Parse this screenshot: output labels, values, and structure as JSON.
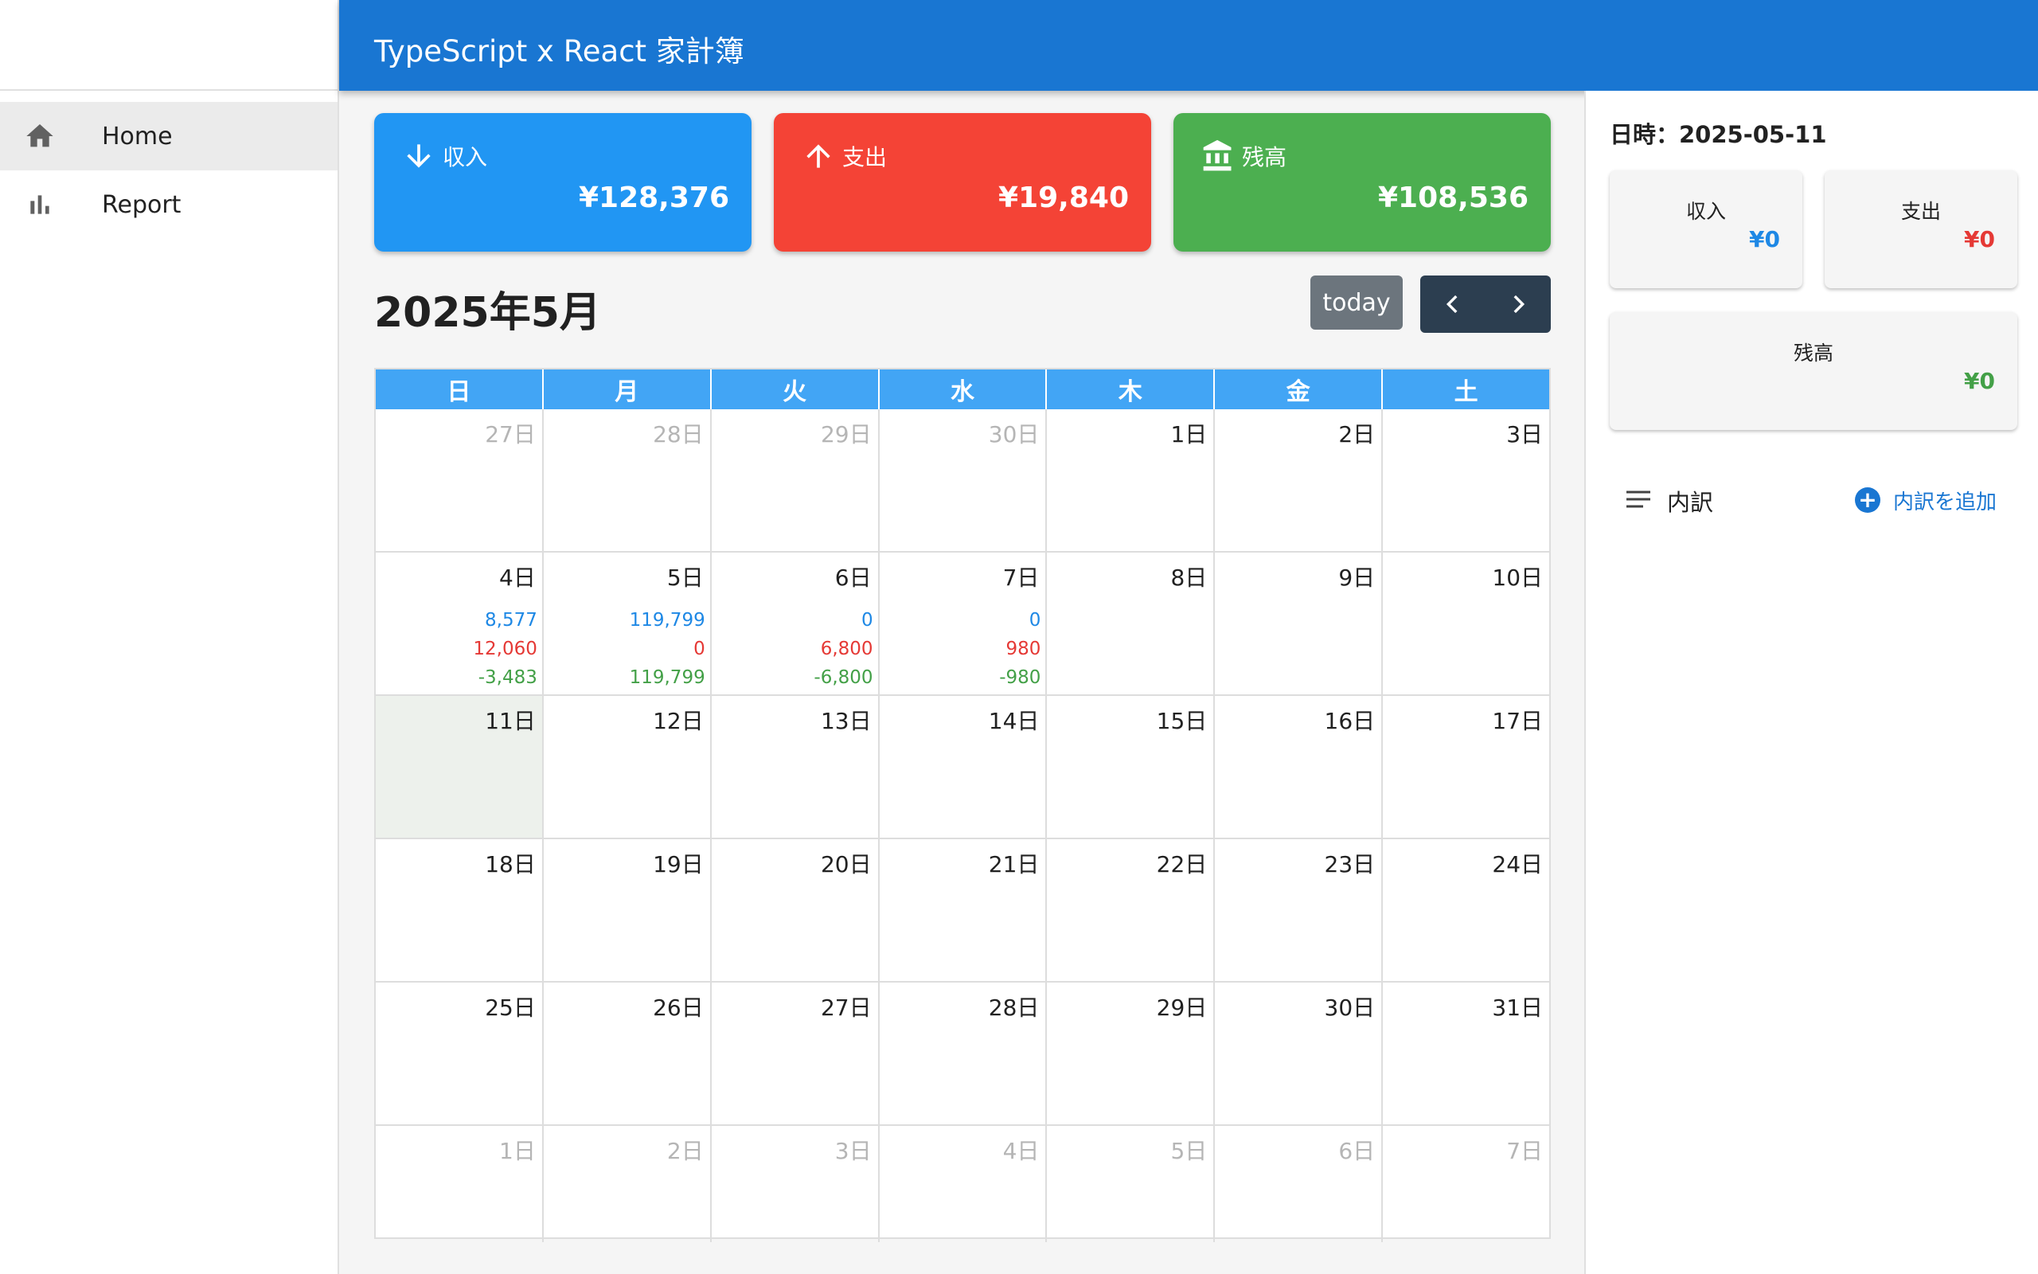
{
  "app": {
    "title": "TypeScript x React 家計簿"
  },
  "sidebar": {
    "items": [
      {
        "label": "Home",
        "icon": "home-icon"
      },
      {
        "label": "Report",
        "icon": "bar-chart-icon"
      }
    ]
  },
  "summary": {
    "income": {
      "label": "収入",
      "amount": "¥128,376",
      "color": "#2196f3"
    },
    "expense": {
      "label": "支出",
      "amount": "¥19,840",
      "color": "#f44336"
    },
    "balance": {
      "label": "残高",
      "amount": "¥108,536",
      "color": "#4caf50"
    }
  },
  "calendar": {
    "month_title": "2025年5月",
    "today_label": "today",
    "weekdays": [
      "日",
      "月",
      "火",
      "水",
      "木",
      "金",
      "土"
    ],
    "weeks": [
      [
        {
          "day": "27日",
          "other": true
        },
        {
          "day": "28日",
          "other": true
        },
        {
          "day": "29日",
          "other": true
        },
        {
          "day": "30日",
          "other": true
        },
        {
          "day": "1日"
        },
        {
          "day": "2日"
        },
        {
          "day": "3日"
        }
      ],
      [
        {
          "day": "4日",
          "income": "8,577",
          "expense": "12,060",
          "balance": "-3,483"
        },
        {
          "day": "5日",
          "income": "119,799",
          "expense": "0",
          "balance": "119,799"
        },
        {
          "day": "6日",
          "income": "0",
          "expense": "6,800",
          "balance": "-6,800"
        },
        {
          "day": "7日",
          "income": "0",
          "expense": "980",
          "balance": "-980"
        },
        {
          "day": "8日"
        },
        {
          "day": "9日"
        },
        {
          "day": "10日"
        }
      ],
      [
        {
          "day": "11日",
          "today": true
        },
        {
          "day": "12日"
        },
        {
          "day": "13日"
        },
        {
          "day": "14日"
        },
        {
          "day": "15日"
        },
        {
          "day": "16日"
        },
        {
          "day": "17日"
        }
      ],
      [
        {
          "day": "18日"
        },
        {
          "day": "19日"
        },
        {
          "day": "20日"
        },
        {
          "day": "21日"
        },
        {
          "day": "22日"
        },
        {
          "day": "23日"
        },
        {
          "day": "24日"
        }
      ],
      [
        {
          "day": "25日"
        },
        {
          "day": "26日"
        },
        {
          "day": "27日"
        },
        {
          "day": "28日"
        },
        {
          "day": "29日"
        },
        {
          "day": "30日"
        },
        {
          "day": "31日"
        }
      ],
      [
        {
          "day": "1日",
          "other": true
        },
        {
          "day": "2日",
          "other": true
        },
        {
          "day": "3日",
          "other": true
        },
        {
          "day": "4日",
          "other": true
        },
        {
          "day": "5日",
          "other": true
        },
        {
          "day": "6日",
          "other": true
        },
        {
          "day": "7日",
          "other": true
        }
      ]
    ]
  },
  "detail": {
    "date_label": "日時：2025-05-11",
    "income": {
      "label": "収入",
      "value": "¥0"
    },
    "expense": {
      "label": "支出",
      "value": "¥0"
    },
    "balance": {
      "label": "残高",
      "value": "¥0"
    },
    "breakdown_label": "内訳",
    "add_label": "内訳を追加"
  }
}
